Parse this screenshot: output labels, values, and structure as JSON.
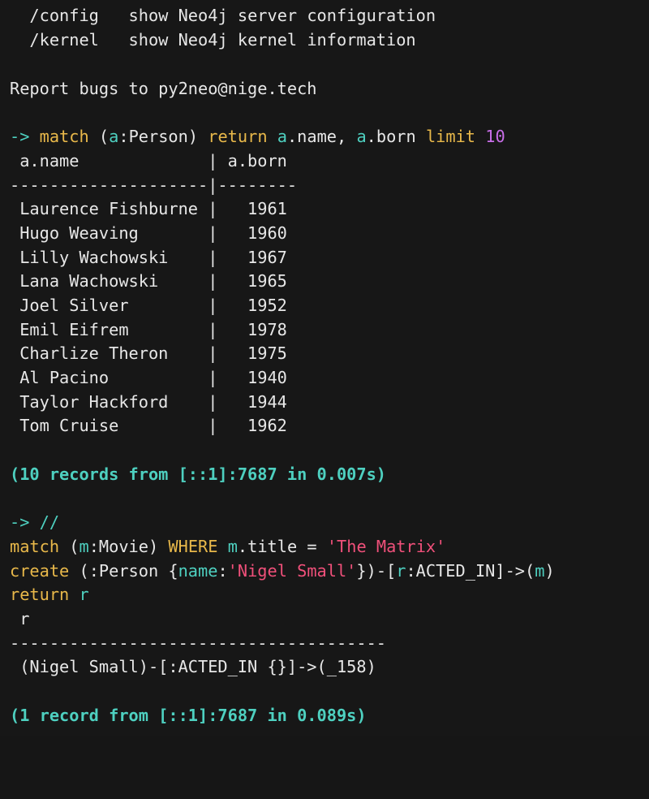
{
  "help": {
    "config_cmd": "/config",
    "config_desc": "show Neo4j server configuration",
    "kernel_cmd": "/kernel",
    "kernel_desc": "show Neo4j kernel information",
    "bug_report": "Report bugs to py2neo@nige.tech"
  },
  "query1": {
    "prompt": "->",
    "match_kw": "match",
    "pattern_open": "(",
    "node_var": "a",
    "node_label": ":Person)",
    "return_kw": "return",
    "col1_var": "a",
    "col1_prop": ".name,",
    "col2_var": "a",
    "col2_prop": ".born",
    "limit_kw": "limit",
    "limit_value": "10",
    "table": {
      "header_line": " a.name             | a.born",
      "separator_line": "--------------------|--------",
      "rows": [
        " Laurence Fishburne |   1961",
        " Hugo Weaving       |   1960",
        " Lilly Wachowski    |   1967",
        " Lana Wachowski     |   1965",
        " Joel Silver        |   1952",
        " Emil Eifrem        |   1978",
        " Charlize Theron    |   1975",
        " Al Pacino          |   1940",
        " Taylor Hackford    |   1944",
        " Tom Cruise         |   1962"
      ]
    },
    "summary": "(10 records from [::1]:7687 in 0.007s)"
  },
  "query2": {
    "prompt": "->",
    "comment": "//",
    "line2": {
      "match_kw": "match",
      "pattern_open": "(",
      "node_var": "m",
      "node_label": ":Movie)",
      "where_kw": "WHERE",
      "prop_var": "m",
      "prop_rest": ".title =",
      "string_value": "'The Matrix'"
    },
    "line3": {
      "create_kw": "create",
      "part1": "(:Person {",
      "key": "name",
      "colon": ":",
      "string_value": "'Nigel Small'",
      "part2": "})-[",
      "rel_var": "r",
      "part3": ":ACTED_IN]->(",
      "target_var": "m",
      "part4": ")"
    },
    "line4": {
      "return_kw": "return",
      "var": "r"
    },
    "result": {
      "header_line": " r",
      "separator_line": "--------------------------------------",
      "row": " (Nigel Small)-[:ACTED_IN {}]->(_158)"
    },
    "summary": "(1 record from [::1]:7687 in 0.089s)"
  }
}
